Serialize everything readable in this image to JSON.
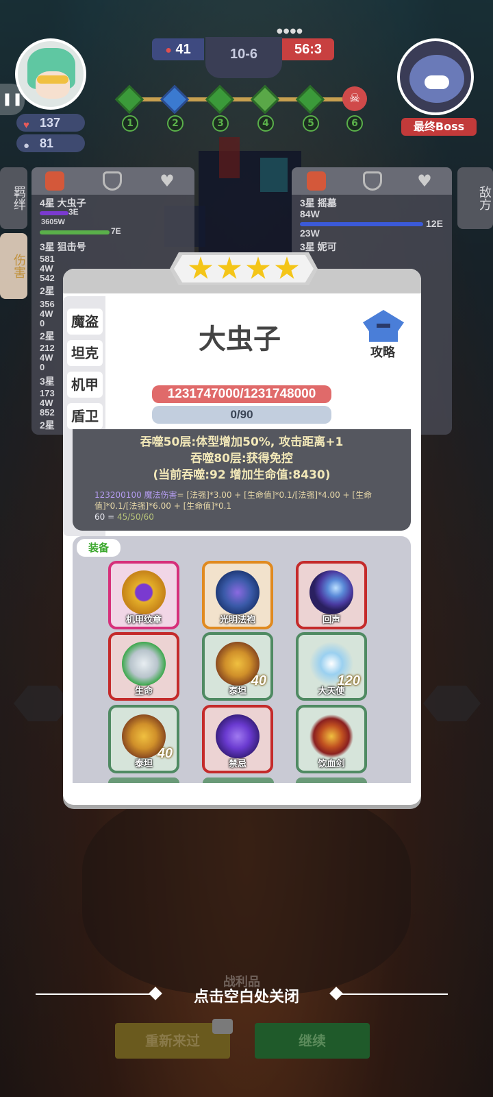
{
  "top": {
    "player_hp": "137",
    "player_shield": "81",
    "score_left": "41",
    "stage": "10-6",
    "score_right": "56:3",
    "progress_nodes": [
      "1",
      "2",
      "3",
      "4",
      "5",
      "6"
    ],
    "boss_label": "最终Boss"
  },
  "left_panel": {
    "tabs": [
      "羁绊",
      "伤害"
    ],
    "lines": [
      "4星 大虫子",
      "3E",
      "3605W",
      "7E",
      "3星 狙击号",
      "581",
      "4W",
      "542",
      "2星",
      "356",
      "4W",
      "0",
      "2星",
      "212",
      "4W",
      "0",
      "3星",
      "173",
      "4W",
      "852",
      "2星"
    ]
  },
  "right_panel": {
    "tab": "敌方",
    "lines": [
      "3星 摇墓",
      "84W",
      "12E",
      "23W",
      "3星 妮可"
    ]
  },
  "modal": {
    "stars": 4,
    "hero_name": "大虫子",
    "guide_label": "攻略",
    "class_tabs": [
      "魔盗",
      "坦克",
      "机甲",
      "盾卫"
    ],
    "hp": "1231747000/1231748000",
    "xp": "0/90",
    "skill_lines": [
      "吞噬50层:体型增加50%, 攻击距离+1",
      "吞噬80层:获得免控",
      "(当前吞噬:92 增加生命值:8430)"
    ],
    "formula_value": "123200100 魔法伤害",
    "formula_text": "= [法强]*3.00 + [生命值]*0.1/[法强]*4.00 + [生命值]*0.1/[法强]*6.00 + [生命值]*0.1",
    "formula_tail_a": "60 = ",
    "formula_tail_b": "45/50/60",
    "equip_label": "装备",
    "items": [
      {
        "name": "机甲纹章",
        "count": ""
      },
      {
        "name": "光明法袍",
        "count": ""
      },
      {
        "name": "回声",
        "count": ""
      },
      {
        "name": "生命",
        "count": ""
      },
      {
        "name": "泰坦",
        "count": "40"
      },
      {
        "name": "大天使",
        "count": "120"
      },
      {
        "name": "泰坦",
        "count": "40"
      },
      {
        "name": "禁忌",
        "count": ""
      },
      {
        "name": "饮血剑",
        "count": ""
      }
    ]
  },
  "close_hint": "点击空白处关闭",
  "footer_label": "战利品",
  "buttons": {
    "retry": "重新来过",
    "continue": "继续"
  },
  "colors": {
    "gold": "#f4c518",
    "hp_red": "#e06a6a",
    "green": "#3aa72c",
    "rarity_red": "#c42a2a",
    "rarity_pink": "#d6307a",
    "rarity_orange": "#e08a20",
    "rarity_green": "#4f8a62"
  }
}
